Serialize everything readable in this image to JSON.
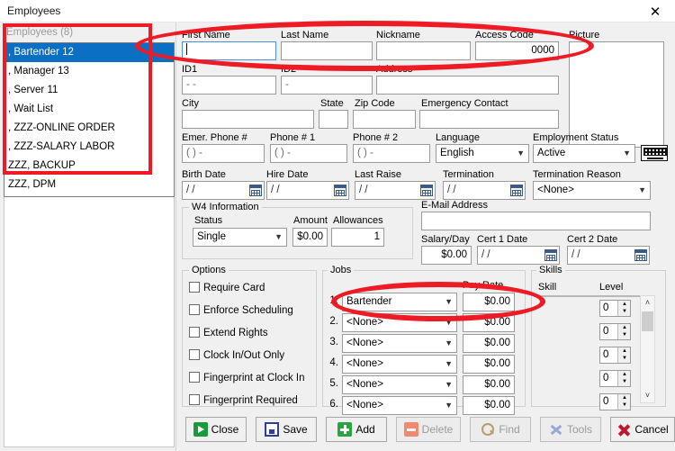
{
  "window": {
    "title": "Employees",
    "close_icon": "close-x-icon"
  },
  "employee_list": {
    "header": "Employees (8)",
    "items": [
      {
        "label": ", Bartender 12",
        "selected": true
      },
      {
        "label": ", Manager 13",
        "selected": false
      },
      {
        "label": ", Server 11",
        "selected": false
      },
      {
        "label": ", Wait List",
        "selected": false
      },
      {
        "label": ", ZZZ-ONLINE ORDER",
        "selected": false
      },
      {
        "label": ", ZZZ-SALARY LABOR",
        "selected": false
      },
      {
        "label": "ZZZ, BACKUP",
        "selected": false
      },
      {
        "label": "ZZZ, DPM",
        "selected": false
      }
    ]
  },
  "form": {
    "first_name": {
      "label": "First Name",
      "value": ""
    },
    "last_name": {
      "label": "Last Name",
      "value": ""
    },
    "nickname": {
      "label": "Nickname",
      "value": ""
    },
    "access_code": {
      "label": "Access Code",
      "value": "0000"
    },
    "picture": {
      "label": "Picture"
    },
    "id1": {
      "label": "ID1",
      "value": "  -  -"
    },
    "id2": {
      "label": "ID2",
      "value": "  -"
    },
    "address": {
      "label": "Address",
      "value": ""
    },
    "city": {
      "label": "City",
      "value": ""
    },
    "state": {
      "label": "State",
      "value": ""
    },
    "zip_code": {
      "label": "Zip Code",
      "value": ""
    },
    "emergency_contact": {
      "label": "Emergency Contact",
      "value": ""
    },
    "emer_phone": {
      "label": "Emer. Phone #",
      "value": "(  )   -"
    },
    "phone1": {
      "label": "Phone # 1",
      "value": "(  )   -"
    },
    "phone2": {
      "label": "Phone # 2",
      "value": "(  )   -"
    },
    "language": {
      "label": "Language",
      "value": "English"
    },
    "employment_status": {
      "label": "Employment Status",
      "value": "Active"
    },
    "keyboard_icon": "on-screen-keyboard-icon",
    "birth_date": {
      "label": "Birth Date",
      "value": "/ /"
    },
    "hire_date": {
      "label": "Hire Date",
      "value": "/ /"
    },
    "last_raise": {
      "label": "Last Raise",
      "value": "/ /"
    },
    "termination": {
      "label": "Termination",
      "value": "/ /"
    },
    "termination_reason": {
      "label": "Termination Reason",
      "value": "<None>"
    },
    "email": {
      "label": "E-Mail Address",
      "value": ""
    },
    "salary_day": {
      "label": "Salary/Day",
      "value": "$0.00"
    },
    "cert1_date": {
      "label": "Cert 1 Date",
      "value": "/ /"
    },
    "cert2_date": {
      "label": "Cert 2 Date",
      "value": "/ /"
    }
  },
  "w4": {
    "group_title": "W4 Information",
    "status_label": "Status",
    "status_value": "Single",
    "amount_label": "Amount",
    "amount_value": "$0.00",
    "allowances_label": "Allowances",
    "allowances_value": "1"
  },
  "options": {
    "group_title": "Options",
    "items": [
      {
        "label": "Require Card",
        "checked": false
      },
      {
        "label": "Enforce Scheduling",
        "checked": false
      },
      {
        "label": "Extend Rights",
        "checked": false
      },
      {
        "label": "Clock In/Out Only",
        "checked": false
      },
      {
        "label": "Fingerprint at Clock In",
        "checked": false
      },
      {
        "label": "Fingerprint Required",
        "checked": false
      }
    ]
  },
  "jobs": {
    "group_title": "Jobs",
    "pay_rate_header": "Pay Rate",
    "rows": [
      {
        "num": "1.",
        "job": "Bartender",
        "pay": "$0.00"
      },
      {
        "num": "2.",
        "job": "<None>",
        "pay": "$0.00"
      },
      {
        "num": "3.",
        "job": "<None>",
        "pay": "$0.00"
      },
      {
        "num": "4.",
        "job": "<None>",
        "pay": "$0.00"
      },
      {
        "num": "5.",
        "job": "<None>",
        "pay": "$0.00"
      },
      {
        "num": "6.",
        "job": "<None>",
        "pay": "$0.00"
      }
    ]
  },
  "skills": {
    "group_title": "Skills",
    "skill_header": "Skill",
    "level_header": "Level",
    "rows": [
      {
        "skill": "",
        "level": "0"
      },
      {
        "skill": "",
        "level": "0"
      },
      {
        "skill": "",
        "level": "0"
      },
      {
        "skill": "",
        "level": "0"
      },
      {
        "skill": "",
        "level": "0"
      }
    ],
    "scroll_up": "˄",
    "scroll_down": "˅"
  },
  "buttons": [
    {
      "key": "close",
      "label": "Close",
      "icon": "close-door-icon",
      "disabled": false
    },
    {
      "key": "save",
      "label": "Save",
      "icon": "floppy-disk-icon",
      "disabled": false
    },
    {
      "key": "add",
      "label": "Add",
      "icon": "plus-icon",
      "disabled": false
    },
    {
      "key": "delete",
      "label": "Delete",
      "icon": "minus-icon",
      "disabled": true
    },
    {
      "key": "find",
      "label": "Find",
      "icon": "magnifier-icon",
      "disabled": true
    },
    {
      "key": "tools",
      "label": "Tools",
      "icon": "wrench-icon",
      "disabled": true
    },
    {
      "key": "cancel",
      "label": "Cancel",
      "icon": "red-x-icon",
      "disabled": false
    }
  ],
  "annotations": {
    "color": "#ee1b24",
    "list_highlight": "red-rectangle-around-employee-list",
    "name_highlight": "red-ellipse-around-name-fields",
    "job_highlight": "red-ellipse-around-first-job-row"
  }
}
